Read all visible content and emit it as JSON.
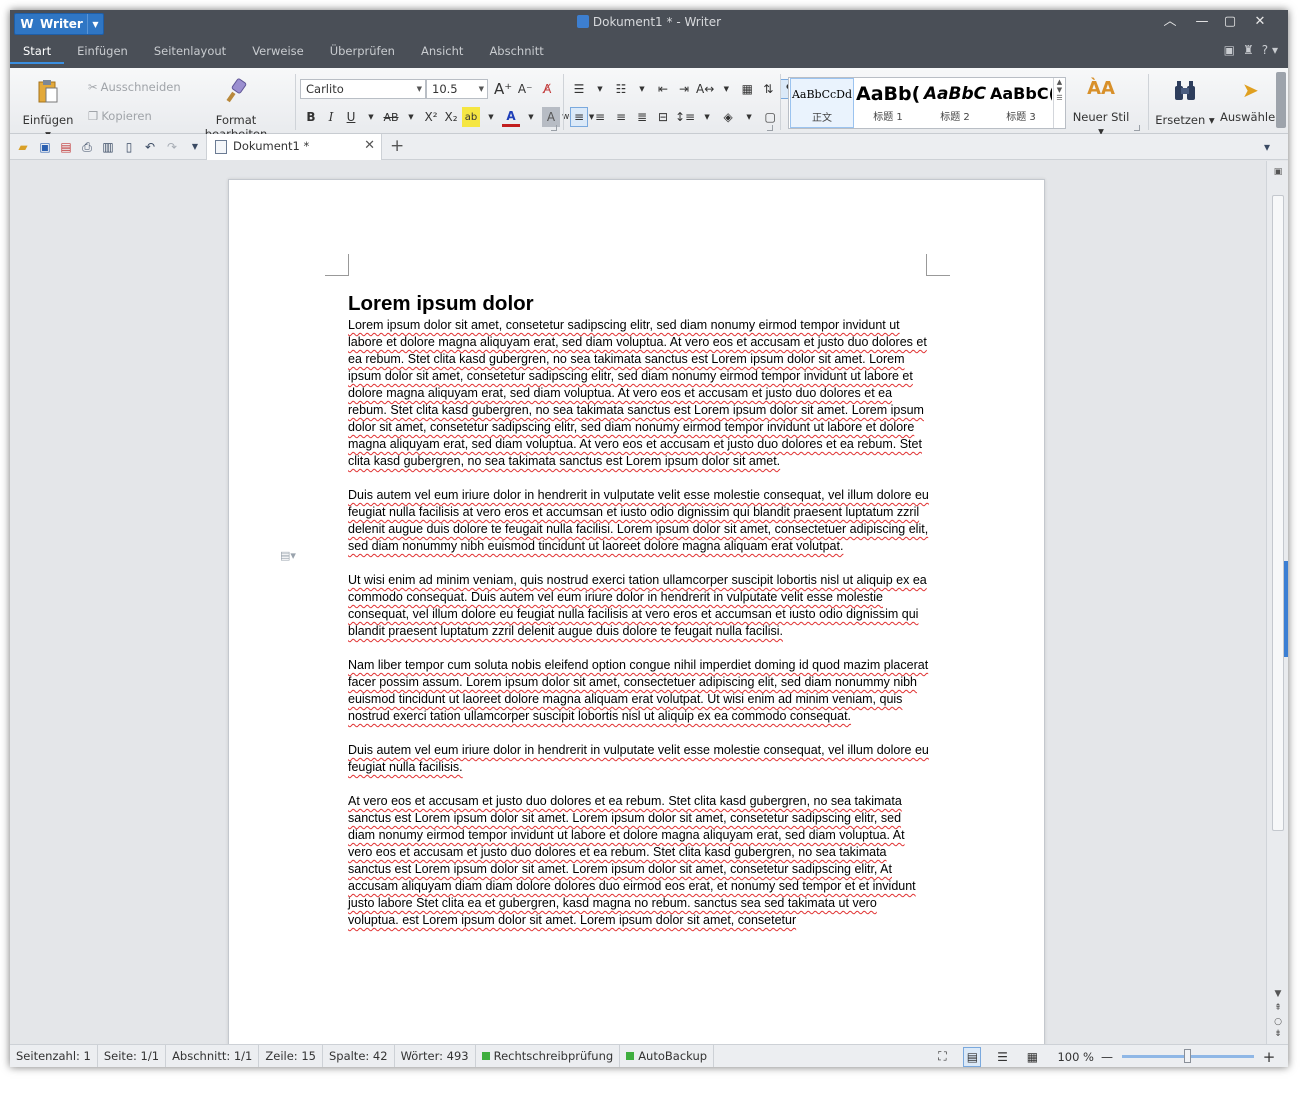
{
  "titlebar": {
    "app_button": "Writer",
    "window_title": "Dokument1 * - Writer",
    "tabs": [
      "Start",
      "Einfügen",
      "Seitenlayout",
      "Verweise",
      "Überprüfen",
      "Ansicht",
      "Abschnitt"
    ],
    "active_tab": "Start",
    "help_label": "?"
  },
  "ribbon": {
    "paste_label": "Einfügen",
    "cut_label": "Ausschneiden",
    "copy_label": "Kopieren",
    "format_painter_label": "Format bearbeiten",
    "font_name": "Carlito",
    "font_size": "10.5",
    "bold": "B",
    "italic": "I",
    "underline": "U",
    "strike": "AB",
    "superscript": "X²",
    "subscript": "X₂",
    "styles": [
      {
        "preview": "AaBbCcDd",
        "name": "正文"
      },
      {
        "preview": "AaBb(",
        "name": "标题 1"
      },
      {
        "preview": "AaBbC",
        "name": "标题 2"
      },
      {
        "preview": "AaBbC(",
        "name": "标题 3"
      }
    ],
    "new_style_label": "Neuer Stil",
    "replace_label": "Ersetzen",
    "select_label": "Auswähle"
  },
  "quickbar": {
    "doc_tab_label": "Dokument1 *"
  },
  "document": {
    "heading": "Lorem ipsum dolor",
    "paragraphs": [
      "Lorem ipsum dolor sit amet, consetetur sadipscing elitr, sed diam nonumy eirmod tempor invidunt ut labore et dolore magna aliquyam erat, sed diam voluptua. At vero eos et accusam et justo duo dolores et ea rebum. Stet clita kasd gubergren, no sea takimata sanctus est Lorem ipsum dolor sit amet. Lorem ipsum dolor sit amet, consetetur sadipscing elitr, sed diam nonumy eirmod tempor invidunt ut labore et dolore magna aliquyam erat, sed diam voluptua. At vero eos et accusam et justo duo dolores et ea rebum. Stet clita kasd gubergren, no sea takimata sanctus est Lorem ipsum dolor sit amet. Lorem ipsum dolor sit amet, consetetur sadipscing elitr, sed diam nonumy eirmod tempor invidunt ut labore et dolore magna aliquyam erat, sed diam voluptua. At vero eos et accusam et justo duo dolores et ea rebum. Stet clita kasd gubergren, no sea takimata sanctus est Lorem ipsum dolor sit amet.",
      "Duis autem vel eum iriure dolor in hendrerit in vulputate velit esse molestie consequat, vel illum dolore eu feugiat nulla facilisis at vero eros et accumsan et iusto odio dignissim qui blandit praesent luptatum zzril delenit augue duis dolore te feugait nulla facilisi. Lorem ipsum dolor sit amet, consectetuer adipiscing elit, sed diam nonummy nibh euismod tincidunt ut laoreet dolore magna aliquam erat volutpat.",
      "Ut wisi enim ad minim veniam, quis nostrud exerci tation ullamcorper suscipit lobortis nisl ut aliquip ex ea commodo consequat. Duis autem vel eum iriure dolor in hendrerit in vulputate velit esse molestie consequat, vel illum dolore eu feugiat nulla facilisis at vero eros et accumsan et iusto odio dignissim qui blandit praesent luptatum zzril delenit augue duis dolore te feugait nulla facilisi.",
      "Nam liber tempor cum soluta nobis eleifend option congue nihil imperdiet doming id quod mazim placerat facer possim assum. Lorem ipsum dolor sit amet, consectetuer adipiscing elit, sed diam nonummy nibh euismod tincidunt ut laoreet dolore magna aliquam erat volutpat. Ut wisi enim ad minim veniam, quis nostrud exerci tation ullamcorper suscipit lobortis nisl ut aliquip ex ea commodo consequat.",
      "Duis autem vel eum iriure dolor in hendrerit in vulputate velit esse molestie consequat, vel illum dolore eu feugiat nulla facilisis.",
      "At vero eos et accusam et justo duo dolores et ea rebum. Stet clita kasd gubergren, no sea takimata sanctus est Lorem ipsum dolor sit amet. Lorem ipsum dolor sit amet, consetetur sadipscing elitr, sed diam nonumy eirmod tempor invidunt ut labore et dolore magna aliquyam erat, sed diam voluptua. At vero eos et accusam et justo duo dolores et ea rebum. Stet clita kasd gubergren, no sea takimata sanctus est Lorem ipsum dolor sit amet. Lorem ipsum dolor sit amet, consetetur sadipscing elitr, At accusam aliquyam diam diam dolore dolores duo eirmod eos erat, et nonumy sed tempor et et invidunt justo labore Stet clita ea et gubergren, kasd magna no rebum. sanctus sea sed takimata ut vero voluptua. est Lorem ipsum dolor sit amet. Lorem ipsum dolor sit amet, consetetur"
    ]
  },
  "statusbar": {
    "page_count": "Seitenzahl: 1",
    "page": "Seite: 1/1",
    "section": "Abschnitt: 1/1",
    "line": "Zeile: 15",
    "column": "Spalte: 42",
    "words": "Wörter: 493",
    "spellcheck": "Rechtschreibprüfung",
    "autobackup": "AutoBackup",
    "zoom": "100 %",
    "zoom_level_percent": 100
  },
  "colors": {
    "accent": "#3b7fd4",
    "titlebar": "#4a4f57",
    "spell_underline": "#e03030",
    "status_ok": "#3fae3f"
  }
}
